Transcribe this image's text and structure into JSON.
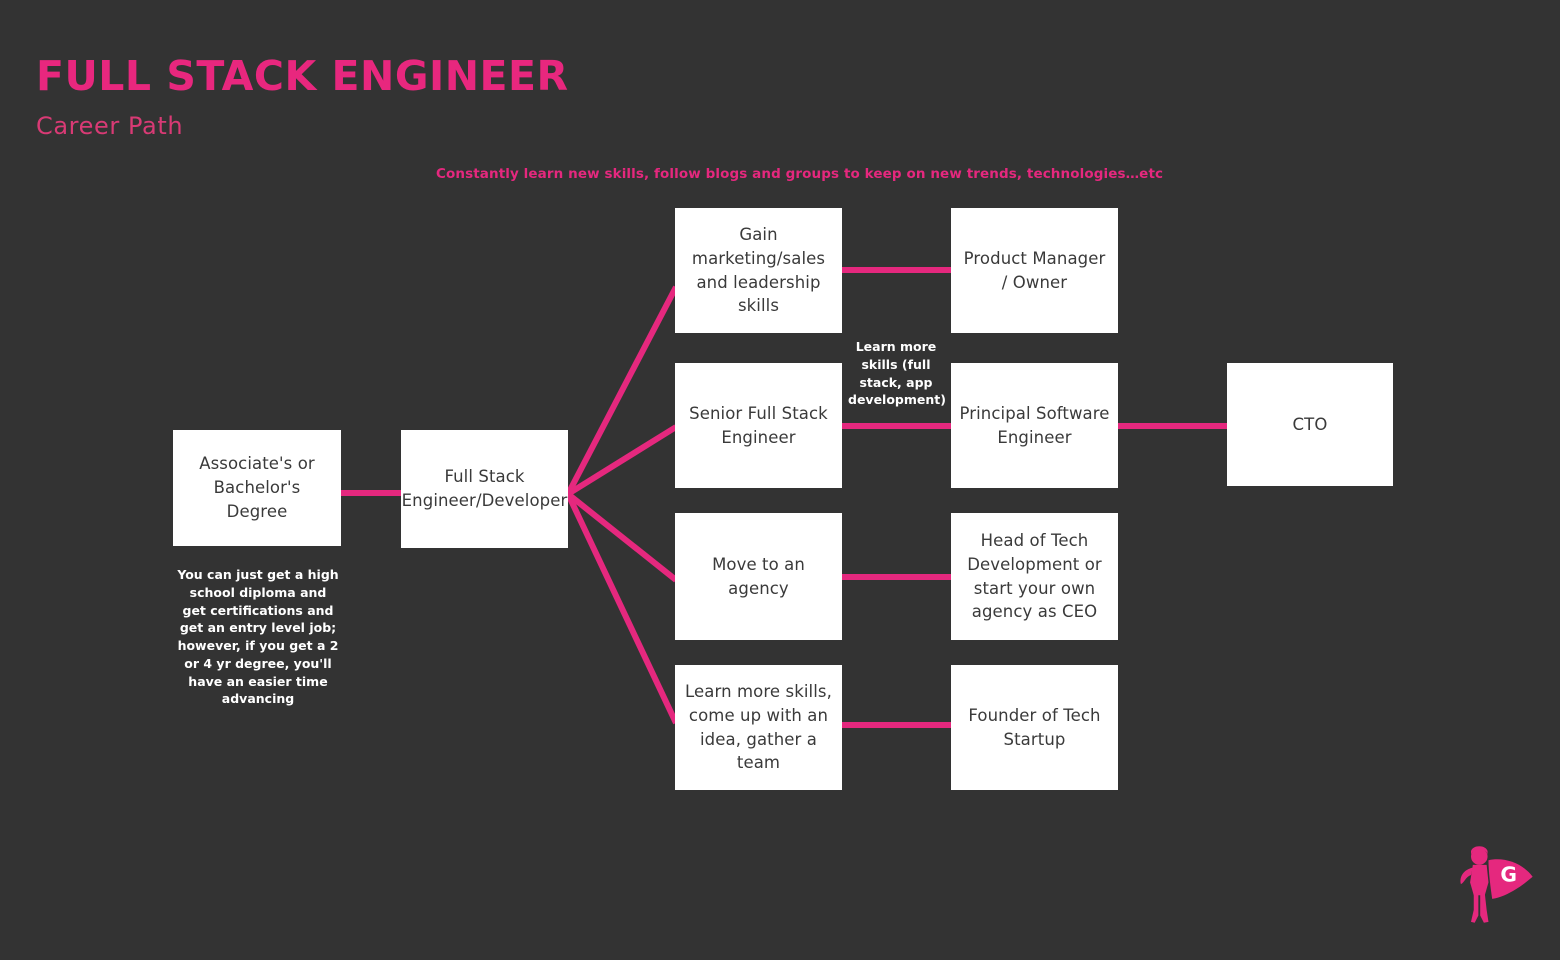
{
  "header": {
    "title": "FULL STACK ENGINEER",
    "subtitle": "Career Path",
    "title_color": "#E8277E",
    "subtitle_color": "#D93A75"
  },
  "theme": {
    "background": "#333333",
    "accent": "#E5287E",
    "node_background": "#FFFFFF",
    "node_text": "#3A3A3A",
    "note_text": "#FFFFFF"
  },
  "annotations": {
    "top_banner": "Constantly learn new skills, follow blogs and groups to keep on new trends, technologies…etc",
    "degree_note": "You can just  get a high school diploma and get certifications and get an entry level job; however, if you get a 2 or 4 yr degree, you'll have an easier time advancing",
    "learn_more_note": "Learn more skills  (full stack, app development)"
  },
  "nodes": {
    "degree": "Associate's or Bachelor's Degree",
    "full_stack": "Full Stack Engineer/Developer",
    "gain_marketing": "Gain marketing/sales and leadership skills",
    "senior_full_stack": "Senior Full Stack Engineer",
    "move_agency": "Move to an agency",
    "learn_skills_team": "Learn more skills, come up with an idea, gather a team",
    "product_manager": "Product Manager / Owner",
    "principal_engineer": "Principal Software Engineer",
    "head_of_tech": "Head of Tech Development or start your own agency as CEO",
    "founder_startup": "Founder of Tech Startup",
    "cto": "CTO"
  },
  "logo": {
    "name": "superhero-logo",
    "letter": "G",
    "color": "#E5287E"
  },
  "chart_data": {
    "type": "diagram",
    "title": "Full Stack Engineer Career Path",
    "edges": [
      {
        "from": "degree",
        "to": "full_stack"
      },
      {
        "from": "full_stack",
        "to": "gain_marketing"
      },
      {
        "from": "full_stack",
        "to": "senior_full_stack"
      },
      {
        "from": "full_stack",
        "to": "move_agency"
      },
      {
        "from": "full_stack",
        "to": "learn_skills_team"
      },
      {
        "from": "gain_marketing",
        "to": "product_manager"
      },
      {
        "from": "senior_full_stack",
        "to": "principal_engineer",
        "label": "Learn more skills  (full stack, app development)"
      },
      {
        "from": "move_agency",
        "to": "head_of_tech"
      },
      {
        "from": "learn_skills_team",
        "to": "founder_startup"
      },
      {
        "from": "principal_engineer",
        "to": "cto"
      }
    ]
  }
}
